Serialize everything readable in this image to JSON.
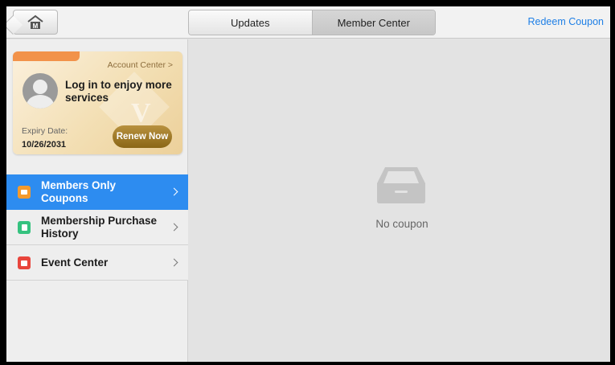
{
  "header": {
    "home_label": "M",
    "tabs": [
      {
        "label": "Updates",
        "active": false
      },
      {
        "label": "Member Center",
        "active": true
      }
    ],
    "redeem_label": "Redeem Coupon"
  },
  "card": {
    "account_center": "Account Center >",
    "login_text": "Log in to enjoy more services",
    "expiry_label": "Expiry Date:",
    "expiry_date": "10/26/2031",
    "renew_label": "Renew Now"
  },
  "menu": {
    "items": [
      {
        "label": "Members Only Coupons",
        "icon": "coupon-icon",
        "color": "#f49a2c",
        "active": true
      },
      {
        "label": "Membership Purchase History",
        "icon": "purchase-history-icon",
        "color": "#35c27f",
        "active": false
      },
      {
        "label": "Event Center",
        "icon": "gift-icon",
        "color": "#e8453c",
        "active": false
      }
    ]
  },
  "main": {
    "empty_icon": "empty-tray-icon",
    "empty_text": "No coupon"
  },
  "colors": {
    "accent": "#2d8cf0",
    "link": "#1e7fe6",
    "renew_button": "#a07a2a"
  }
}
